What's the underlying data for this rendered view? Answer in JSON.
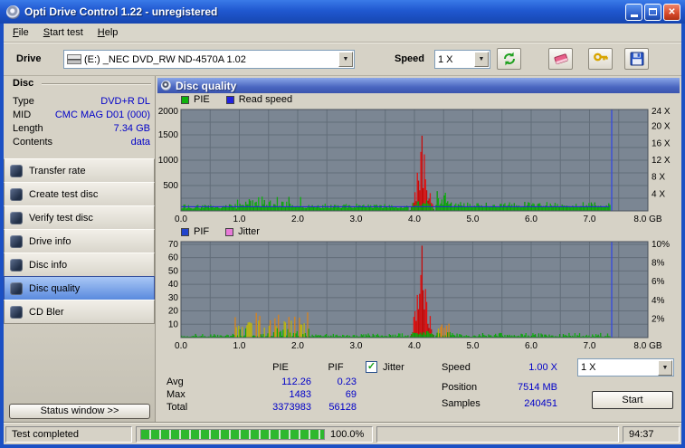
{
  "window": {
    "title": "Opti Drive Control 1.22 - unregistered"
  },
  "menu": {
    "items": [
      {
        "label": "File"
      },
      {
        "label": "Start test"
      },
      {
        "label": "Help"
      }
    ]
  },
  "toolbar": {
    "drive_label": "Drive",
    "drive_value": "(E:) _NEC DVD_RW ND-4570A 1.02",
    "speed_label": "Speed",
    "speed_value": "1 X"
  },
  "disc_panel": {
    "title": "Disc",
    "rows": [
      {
        "label": "Type",
        "value": "DVD+R DL"
      },
      {
        "label": "MID",
        "value": "CMC MAG D01 (000)"
      },
      {
        "label": "Length",
        "value": "7.34 GB"
      },
      {
        "label": "Contents",
        "value": "data"
      }
    ]
  },
  "sidebar": {
    "items": [
      {
        "label": "Transfer rate"
      },
      {
        "label": "Create test disc"
      },
      {
        "label": "Verify test disc"
      },
      {
        "label": "Drive info"
      },
      {
        "label": "Disc info"
      },
      {
        "label": "Disc quality",
        "selected": true
      },
      {
        "label": "CD Bler"
      }
    ],
    "status_window": "Status window >>"
  },
  "main": {
    "header": "Disc quality"
  },
  "stats": {
    "col_pie": "PIE",
    "col_pif": "PIF",
    "jitter_label": "Jitter",
    "jitter_checked": true,
    "rows": [
      {
        "label": "Avg",
        "pie": "112.26",
        "pif": "0.23"
      },
      {
        "label": "Max",
        "pie": "1483",
        "pif": "69"
      },
      {
        "label": "Total",
        "pie": "3373983",
        "pif": "56128"
      }
    ],
    "speed_label": "Speed",
    "speed_value": "1.00 X",
    "speed_select": "1 X",
    "position_label": "Position",
    "position_value": "7514 MB",
    "samples_label": "Samples",
    "samples_value": "240451",
    "start_label": "Start"
  },
  "statusbar": {
    "text": "Test completed",
    "percent": "100.0%",
    "time": "94:37"
  },
  "chart_data": [
    {
      "type": "bar",
      "name": "PIE and read speed vs disc position",
      "legend": [
        {
          "label": "PIE",
          "color": "#0db20d"
        },
        {
          "label": "Read speed",
          "color": "#2222dd"
        }
      ],
      "x_max": 8,
      "data_end": 7.34,
      "x_ticks": [
        {
          "label": "0.0",
          "v": 0
        },
        {
          "label": "1.0",
          "v": 1
        },
        {
          "label": "2.0",
          "v": 2
        },
        {
          "label": "3.0",
          "v": 3
        },
        {
          "label": "4.0",
          "v": 4
        },
        {
          "label": "5.0",
          "v": 5
        },
        {
          "label": "6.0",
          "v": 6
        },
        {
          "label": "7.0",
          "v": 7
        },
        {
          "label": "8.0 GB",
          "v": 8
        }
      ],
      "y_max": 2000,
      "h_grid": 250,
      "left_ticks": [
        {
          "label": "2000",
          "v": 2000
        },
        {
          "label": "1500",
          "v": 1500
        },
        {
          "label": "1000",
          "v": 1000
        },
        {
          "label": "500",
          "v": 500
        }
      ],
      "right_ticks": [
        {
          "label": "24 X",
          "v": 2000
        },
        {
          "label": "20 X",
          "v": 1667
        },
        {
          "label": "16 X",
          "v": 1333
        },
        {
          "label": "12 X",
          "v": 1000
        },
        {
          "label": "8 X",
          "v": 667
        },
        {
          "label": "4 X",
          "v": 333
        }
      ],
      "segments": [
        {
          "from": 0,
          "to": 0.95,
          "base": 45,
          "var": 90,
          "skew": 2,
          "palette": "green"
        },
        {
          "from": 0.95,
          "to": 2.05,
          "base": 70,
          "var": 220,
          "skew": 2,
          "palette": "green"
        },
        {
          "from": 2.05,
          "to": 3.9,
          "base": 55,
          "var": 90,
          "skew": 2,
          "palette": "green"
        },
        {
          "from": 3.9,
          "to": 4.34,
          "mode": "spike",
          "center": 4.12,
          "peak": 1483,
          "gbase": 220,
          "palette": "red"
        },
        {
          "from": 4.34,
          "to": 4.62,
          "base": 110,
          "var": 330,
          "skew": 2,
          "palette": "green"
        },
        {
          "from": 4.62,
          "to": 7.34,
          "base": 70,
          "var": 110,
          "skew": 2,
          "palette": "green"
        }
      ],
      "read_speed_line": {
        "v": 83,
        "color": "#2222dd"
      },
      "marker": {
        "v": 7.38,
        "color": "#2f46e8"
      },
      "summary": {
        "avg": 112.26,
        "max": 1483,
        "total": 3373983
      }
    },
    {
      "type": "bar",
      "name": "PIF and jitter vs disc position",
      "legend": [
        {
          "label": "PIF",
          "color": "#2244cc"
        },
        {
          "label": "Jitter",
          "color": "#e87ad8"
        }
      ],
      "x_max": 8,
      "data_end": 7.34,
      "x_ticks": [
        {
          "label": "0.0",
          "v": 0
        },
        {
          "label": "1.0",
          "v": 1
        },
        {
          "label": "2.0",
          "v": 2
        },
        {
          "label": "3.0",
          "v": 3
        },
        {
          "label": "4.0",
          "v": 4
        },
        {
          "label": "5.0",
          "v": 5
        },
        {
          "label": "6.0",
          "v": 6
        },
        {
          "label": "7.0",
          "v": 7
        },
        {
          "label": "8.0 GB",
          "v": 8
        }
      ],
      "y_max": 72,
      "h_grid": 10,
      "left_ticks": [
        {
          "label": "70",
          "v": 70
        },
        {
          "label": "60",
          "v": 60
        },
        {
          "label": "50",
          "v": 50
        },
        {
          "label": "40",
          "v": 40
        },
        {
          "label": "30",
          "v": 30
        },
        {
          "label": "20",
          "v": 20
        },
        {
          "label": "10",
          "v": 10
        }
      ],
      "right_ticks": [
        {
          "label": "10%",
          "v": 70
        },
        {
          "label": "8%",
          "v": 56
        },
        {
          "label": "6%",
          "v": 42
        },
        {
          "label": "4%",
          "v": 28
        },
        {
          "label": "2%",
          "v": 14
        }
      ],
      "segments": [
        {
          "from": 0,
          "to": 0.9,
          "base": 0.6,
          "var": 2.4,
          "skew": 2,
          "palette": "green"
        },
        {
          "from": 0.9,
          "to": 2.2,
          "base": 1,
          "var": 19,
          "skew": 2.4,
          "palette": "heat"
        },
        {
          "from": 2.2,
          "to": 3.9,
          "base": 0.6,
          "var": 2.6,
          "skew": 2,
          "palette": "green"
        },
        {
          "from": 3.9,
          "to": 4.34,
          "mode": "spike",
          "center": 4.12,
          "peak": 69,
          "gbase": 5,
          "palette": "red"
        },
        {
          "from": 4.34,
          "to": 4.62,
          "base": 1.5,
          "var": 9,
          "skew": 2,
          "palette": "heat"
        },
        {
          "from": 4.62,
          "to": 7.34,
          "base": 0.6,
          "var": 3,
          "skew": 2,
          "palette": "green"
        }
      ],
      "marker": {
        "v": 7.38,
        "color": "#2f46e8"
      },
      "summary": {
        "avg": 0.23,
        "max": 69,
        "total": 56128
      }
    }
  ]
}
